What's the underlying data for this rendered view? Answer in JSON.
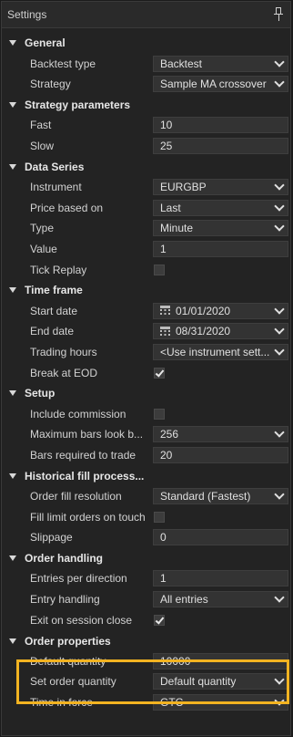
{
  "panel": {
    "title": "Settings"
  },
  "sections": {
    "general": {
      "title": "General",
      "backtest_type": {
        "label": "Backtest type",
        "value": "Backtest"
      },
      "strategy": {
        "label": "Strategy",
        "value": "Sample MA crossover"
      }
    },
    "strategy_parameters": {
      "title": "Strategy parameters",
      "fast": {
        "label": "Fast",
        "value": "10"
      },
      "slow": {
        "label": "Slow",
        "value": "25"
      }
    },
    "data_series": {
      "title": "Data Series",
      "instrument": {
        "label": "Instrument",
        "value": "EURGBP"
      },
      "price_based_on": {
        "label": "Price based on",
        "value": "Last"
      },
      "type": {
        "label": "Type",
        "value": "Minute"
      },
      "value": {
        "label": "Value",
        "value": "1"
      },
      "tick_replay": {
        "label": "Tick Replay",
        "checked": false
      }
    },
    "time_frame": {
      "title": "Time frame",
      "start_date": {
        "label": "Start date",
        "value": "01/01/2020"
      },
      "end_date": {
        "label": "End date",
        "value": "08/31/2020"
      },
      "trading_hours": {
        "label": "Trading hours",
        "value": "<Use instrument sett..."
      },
      "break_at_eod": {
        "label": "Break at EOD",
        "checked": true
      }
    },
    "setup": {
      "title": "Setup",
      "include_commission": {
        "label": "Include commission",
        "checked": false
      },
      "max_bars_look_back": {
        "label": "Maximum bars look b...",
        "value": "256"
      },
      "bars_required_to_trade": {
        "label": "Bars required to trade",
        "value": "20"
      }
    },
    "historical_fill": {
      "title": "Historical fill process...",
      "order_fill_resolution": {
        "label": "Order fill resolution",
        "value": "Standard (Fastest)"
      },
      "fill_limit_orders_on_touch": {
        "label": "Fill limit orders on touch",
        "checked": false
      },
      "slippage": {
        "label": "Slippage",
        "value": "0"
      }
    },
    "order_handling": {
      "title": "Order handling",
      "entries_per_direction": {
        "label": "Entries per direction",
        "value": "1"
      },
      "entry_handling": {
        "label": "Entry handling",
        "value": "All entries"
      },
      "exit_on_session_close": {
        "label": "Exit on session close",
        "checked": true
      }
    },
    "order_properties": {
      "title": "Order properties",
      "default_quantity": {
        "label": "Default quantity",
        "value": "10000"
      },
      "set_order_quantity": {
        "label": "Set order quantity",
        "value": "Default quantity"
      },
      "time_in_force": {
        "label": "Time in force",
        "value": "GTC"
      }
    }
  },
  "icons": [
    "pin-icon",
    "collapse-triangle-icon",
    "chevron-down-icon",
    "calendar-icon",
    "checkmark-icon"
  ],
  "colors": {
    "highlight": "#f2b321",
    "background": "#232323",
    "field": "#333333"
  }
}
